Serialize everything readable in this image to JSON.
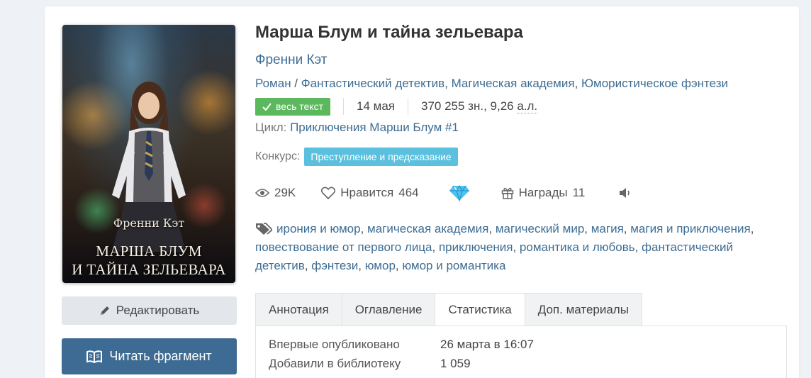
{
  "book": {
    "title": "Марша Блум и тайна зельевара",
    "author": "Френни Кэт",
    "genre_main": "Роман",
    "genre_slash": " / ",
    "genres": [
      "Фантастический детектив",
      "Магическая академия",
      "Юмористическое фэнтези"
    ],
    "full_text_badge": "весь текст",
    "date": "14 мая",
    "chars": "370 255 зн., 9,26 ",
    "chars_unit": "а.л.",
    "cycle_label": "Цикл:",
    "cycle_value": "Приключения Марши Блум #1",
    "contest_label": "Конкурс:",
    "contest_value": "Преступление и предсказание"
  },
  "cover": {
    "author": "Френни Кэт",
    "title_line1": "МАРША БЛУМ",
    "title_line2": "И ТАЙНА ЗЕЛЬЕВАРА"
  },
  "stats": {
    "views": "29K",
    "likes_label": "Нравится",
    "likes": "464",
    "awards_label": "Награды",
    "awards": "11"
  },
  "tags": [
    "ирония и юмор",
    "магическая академия",
    "магический мир",
    "магия",
    "магия и приключения",
    "повествование от первого лица",
    "приключения",
    "романтика и любовь",
    "фантастический детектив",
    "фэнтези",
    "юмор",
    "юмор и романтика"
  ],
  "buttons": {
    "edit": "Редактировать",
    "read": "Читать фрагмент"
  },
  "tabs": [
    "Аннотация",
    "Оглавление",
    "Статистика",
    "Доп. материалы"
  ],
  "statistics": {
    "first_published_label": "Впервые опубликовано",
    "first_published": "26 марта в 16:07",
    "library_label": "Добавили в библиотеку",
    "library": "1 059"
  },
  "colors": {
    "link": "#3d6d94",
    "read_button": "#3e6b93",
    "full_text_badge": "#5cb85c",
    "contest_badge": "#5bc0de"
  }
}
